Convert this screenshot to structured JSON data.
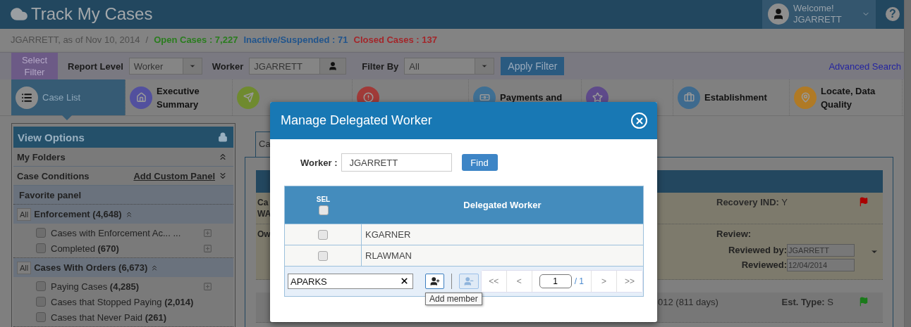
{
  "header": {
    "title": "Track My Cases",
    "welcome": "Welcome!",
    "user": "JGARRETT",
    "help": "?"
  },
  "status": {
    "as_of": "JGARRETT, as of Nov 10, 2014",
    "separator": "/",
    "counts": [
      {
        "label": "Open Cases : 7,227",
        "color": "#2a7d1e"
      },
      {
        "label": "Inactive/Suspended : 71",
        "color": "#22558c"
      },
      {
        "label": "Closed Cases : 137",
        "color": "#a3262a"
      }
    ]
  },
  "filter_bar": {
    "select_filter": "Select Filter",
    "report_level_label": "Report Level",
    "report_level": "Worker",
    "worker_label": "Worker",
    "worker": "JGARRETT",
    "filter_by_label": "Filter By",
    "filter_by": "All",
    "apply": "Apply Filter",
    "advanced_search": "Advanced Search"
  },
  "nav": [
    {
      "kind": "list",
      "label": "Case List",
      "selected": true,
      "color": "#8c8c8c"
    },
    {
      "kind": "home",
      "label": "Executive Summary",
      "selected": false,
      "color": "#52509e"
    },
    {
      "kind": "send",
      "selected": false,
      "color": "#6f8a2f"
    },
    {
      "kind": "alert",
      "selected": false,
      "color": "#a03a38"
    },
    {
      "kind": "money",
      "label": "Payments and",
      "selected": false,
      "color": "#3e6f93"
    },
    {
      "kind": "star",
      "selected": false,
      "color": "#5e4a8a"
    },
    {
      "kind": "briefcase",
      "label": "Establishment",
      "selected": false,
      "color": "#3e6a8e"
    },
    {
      "kind": "pin",
      "label": "Locate, Data Quality",
      "selected": false,
      "color": "#b07a25"
    }
  ],
  "left_panel": {
    "title": "View Options",
    "sections": [
      {
        "title": "My Folders",
        "expanded": true
      },
      {
        "title": "Case Conditions",
        "link": "Add Custom Panel",
        "expanded": false
      }
    ],
    "favorite": "Favorite panel",
    "groups": [
      {
        "all": "All",
        "title": "Enforcement (4,648)",
        "expanded": true,
        "items": [
          {
            "label": "Cases with Enforcement Ac... ...",
            "checked": false,
            "expandable": true
          },
          {
            "label": "Completed **(670)**",
            "checked": false,
            "expandable": true
          }
        ]
      },
      {
        "all": "All",
        "title": "Cases With Orders (6,673)",
        "expanded": true,
        "items": [
          {
            "label": "Paying Cases **(4,285)**",
            "checked": false,
            "expandable": true
          },
          {
            "label": "Cases that Stopped Paying **(2,014)**",
            "checked": false,
            "expandable": false
          },
          {
            "label": "Cases that Never Paid **(261)**",
            "checked": false,
            "expandable": false
          }
        ]
      }
    ]
  },
  "case_card": {
    "tab": "Ca",
    "row_1": {
      "left": [
        "Ca",
        "WA"
      ],
      "recovery": "**Recovery IND:** Y",
      "flag": {
        "color": "#aa0000"
      }
    },
    "row_2": {
      "left": "Ow",
      "review_label": "Review:",
      "reviewed_by_label": "Reviewed by:",
      "reviewed_by": "JGARRETT",
      "reviewed_label": "Reviewed:",
      "reviewed": "12/04/2014"
    },
    "row_3": {
      "date": "012 (811 days)",
      "est_type": "**Est. Type:** S",
      "flag": {
        "color": "#1a7a1a"
      }
    }
  },
  "modal": {
    "title": "Manage Delegated Worker",
    "worker_label": "Worker :",
    "worker": "JGARRETT",
    "find": "Find",
    "columns": [
      "SEL",
      "Delegated Worker"
    ],
    "select_all_checked": false,
    "rows": [
      {
        "name": "KGARNER",
        "checked": false
      },
      {
        "name": "RLAWMAN",
        "checked": false
      }
    ],
    "add_field": "APARKS",
    "remove_disabled": true,
    "tooltip": "Add member",
    "pager": {
      "first": "<<",
      "prev": "<",
      "page": "1",
      "total": "/ 1",
      "next": ">",
      "last": ">>"
    }
  }
}
